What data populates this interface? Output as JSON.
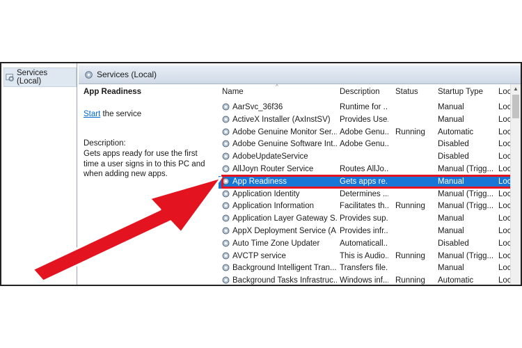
{
  "tree": {
    "label": "Services (Local)"
  },
  "header": {
    "title": "Services (Local)"
  },
  "detail": {
    "service_name": "App Readiness",
    "start_link": "Start",
    "start_suffix": " the service",
    "desc_label": "Description:",
    "desc_text": "Gets apps ready for use the first time a user signs in to this PC and when adding new apps."
  },
  "columns": {
    "name": "Name",
    "description": "Description",
    "status": "Status",
    "startup": "Startup Type",
    "log": "Loc"
  },
  "rows": [
    {
      "name": "AarSvc_36f36",
      "description": "Runtime for ...",
      "status": "",
      "startup": "Manual",
      "log": "Loc"
    },
    {
      "name": "ActiveX Installer (AxInstSV)",
      "description": "Provides Use...",
      "status": "",
      "startup": "Manual",
      "log": "Loc"
    },
    {
      "name": "Adobe Genuine Monitor Ser...",
      "description": "Adobe Genu...",
      "status": "Running",
      "startup": "Automatic",
      "log": "Loc"
    },
    {
      "name": "Adobe Genuine Software Int...",
      "description": "Adobe Genu...",
      "status": "",
      "startup": "Disabled",
      "log": "Loc"
    },
    {
      "name": "AdobeUpdateService",
      "description": "",
      "status": "",
      "startup": "Disabled",
      "log": "Loc"
    },
    {
      "name": "AllJoyn Router Service",
      "description": "Routes AllJo...",
      "status": "",
      "startup": "Manual (Trigg...",
      "log": "Loc"
    },
    {
      "name": "App Readiness",
      "description": "Gets apps re...",
      "status": "",
      "startup": "Manual",
      "log": "Loc"
    },
    {
      "name": "Application Identity",
      "description": "Determines ...",
      "status": "",
      "startup": "Manual (Trigg...",
      "log": "Loc"
    },
    {
      "name": "Application Information",
      "description": "Facilitates th...",
      "status": "Running",
      "startup": "Manual (Trigg...",
      "log": "Loc"
    },
    {
      "name": "Application Layer Gateway S...",
      "description": "Provides sup...",
      "status": "",
      "startup": "Manual",
      "log": "Loc"
    },
    {
      "name": "AppX Deployment Service (A...",
      "description": "Provides infr...",
      "status": "",
      "startup": "Manual",
      "log": "Loc"
    },
    {
      "name": "Auto Time Zone Updater",
      "description": "Automaticall...",
      "status": "",
      "startup": "Disabled",
      "log": "Loc"
    },
    {
      "name": "AVCTP service",
      "description": "This is Audio...",
      "status": "Running",
      "startup": "Manual (Trigg...",
      "log": "Loc"
    },
    {
      "name": "Background Intelligent Tran...",
      "description": "Transfers file...",
      "status": "",
      "startup": "Manual",
      "log": "Loc"
    },
    {
      "name": "Background Tasks Infrastruc...",
      "description": "Windows inf...",
      "status": "Running",
      "startup": "Automatic",
      "log": "Loc"
    }
  ],
  "colors": {
    "selection": "#1877d6",
    "highlight": "#e3141f",
    "link": "#0066cc"
  }
}
